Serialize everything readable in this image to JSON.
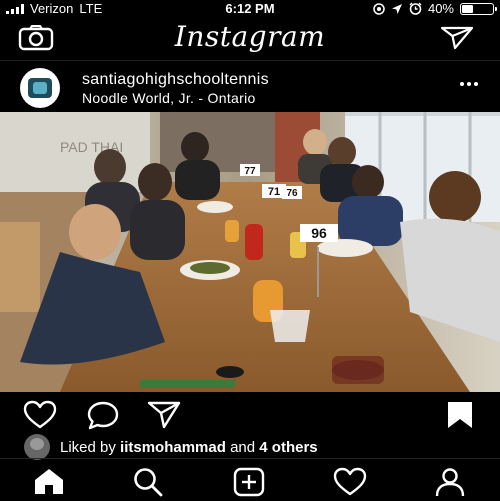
{
  "status_bar": {
    "carrier": "Verizon",
    "network": "LTE",
    "time": "6:12 PM",
    "battery_percent": "40%",
    "battery_level": 0.4,
    "icons": [
      "signal-icon",
      "location-arrow-icon",
      "alarm-icon",
      "battery-icon"
    ]
  },
  "header": {
    "title": "Instagram",
    "icons": [
      "camera-icon",
      "direct-message-icon"
    ]
  },
  "post": {
    "username": "santiagohighschooltennis",
    "location": "Noodle World, Jr. - Ontario",
    "photo": {
      "menu_board": "PAD THAI",
      "table_number": "96",
      "table_numbers_background": [
        "71",
        "76",
        "77"
      ]
    },
    "likes": {
      "prefix": "Liked by ",
      "user": "iitsmohammad",
      "middle": " and ",
      "others": "4 others"
    },
    "action_icons": [
      "heart-icon",
      "comment-icon",
      "share-icon",
      "bookmark-icon"
    ]
  },
  "tab_bar": {
    "icons": [
      "home-icon",
      "search-icon",
      "new-post-icon",
      "activity-heart-icon",
      "profile-icon"
    ]
  },
  "colors": {
    "background": "#000000",
    "text": "#ffffff",
    "divider": "#262626"
  }
}
